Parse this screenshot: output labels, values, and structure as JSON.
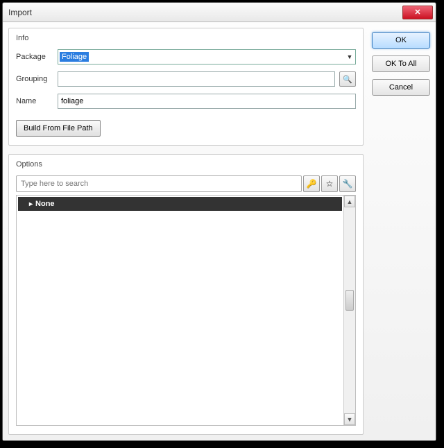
{
  "window": {
    "title": "Import"
  },
  "info": {
    "title": "Info",
    "package_label": "Package",
    "package_value": "Foliage",
    "grouping_label": "Grouping",
    "grouping_value": "",
    "name_label": "Name",
    "name_value": "foliage",
    "build_button": "Build From File Path"
  },
  "options": {
    "title": "Options",
    "search_placeholder": "Type here to search",
    "none_label": "None"
  },
  "buttons": {
    "ok": "OK",
    "ok_all": "OK To All",
    "cancel": "Cancel"
  },
  "icons": {
    "close": "✕",
    "dropdown": "▼",
    "binoculars": "🔍",
    "search": "🔑",
    "star": "☆",
    "wrench": "🔧",
    "up": "▲",
    "down": "▼"
  }
}
